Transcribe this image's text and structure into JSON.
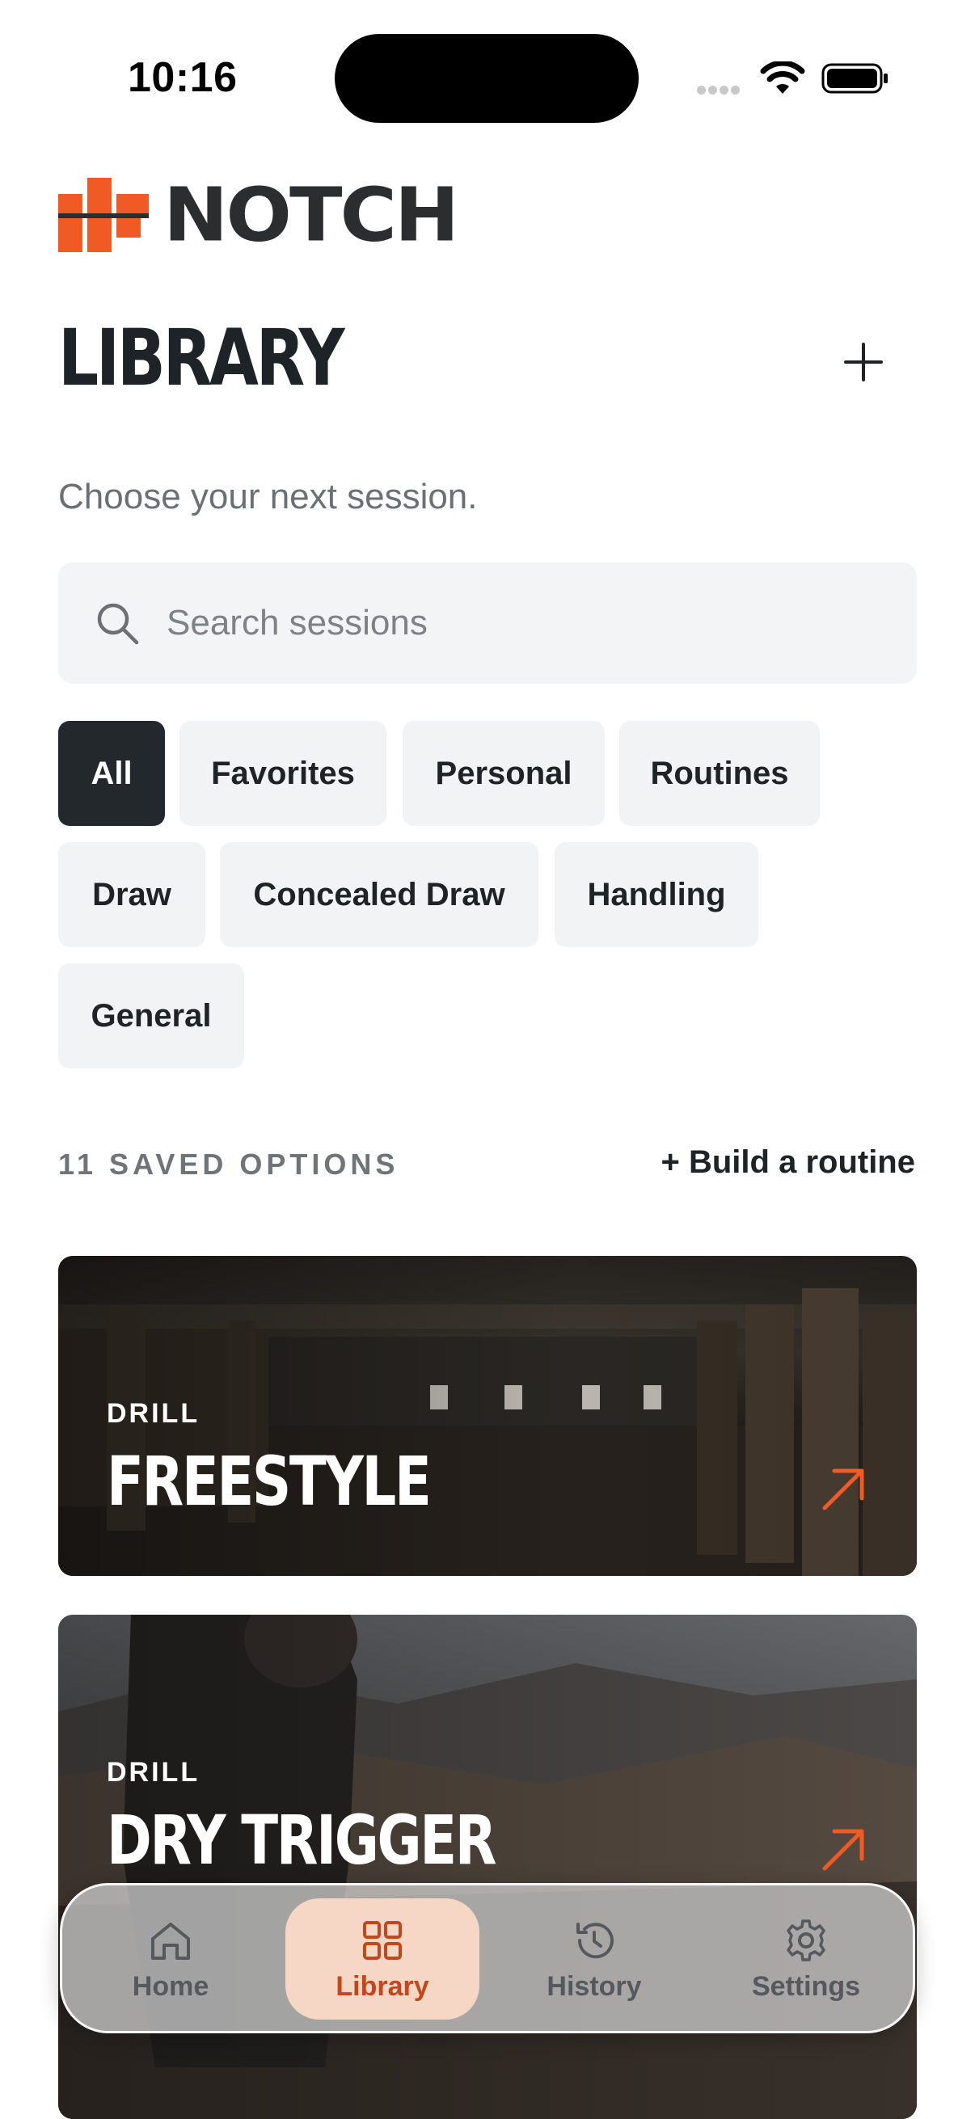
{
  "status_bar": {
    "time": "10:16"
  },
  "brand": {
    "name": "NOTCH",
    "accent_color": "#f05a24"
  },
  "header": {
    "title": "LIBRARY",
    "add_icon": "plus-icon"
  },
  "subtitle": "Choose your next session.",
  "search": {
    "placeholder": "Search sessions",
    "value": ""
  },
  "filters": {
    "selected": "All",
    "chips": [
      "All",
      "Favorites",
      "Personal",
      "Routines",
      "Draw",
      "Concealed Draw",
      "Handling",
      "General"
    ]
  },
  "section": {
    "count_label": "11 SAVED OPTIONS",
    "build_link": "+ Build a routine"
  },
  "sessions": [
    {
      "kind": "DRILL",
      "title": "FREESTYLE",
      "icon": "arrow-up-right-icon"
    },
    {
      "kind": "DRILL",
      "title": "DRY TRIGGER",
      "icon": "arrow-up-right-icon"
    }
  ],
  "tab_bar": {
    "active": "Library",
    "tabs": [
      {
        "label": "Home",
        "icon": "home-icon"
      },
      {
        "label": "Library",
        "icon": "grid-icon"
      },
      {
        "label": "History",
        "icon": "history-icon"
      },
      {
        "label": "Settings",
        "icon": "gear-icon"
      }
    ]
  }
}
